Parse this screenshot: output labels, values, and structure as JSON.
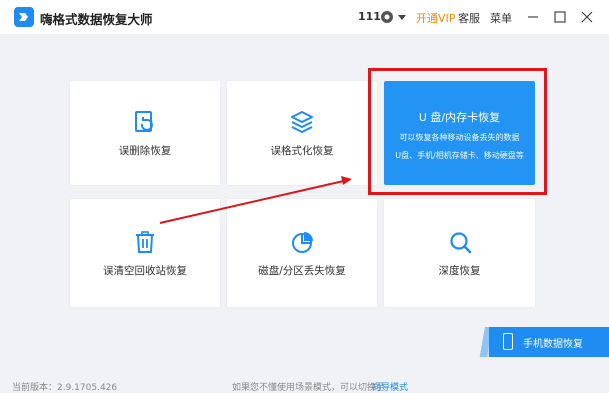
{
  "app": {
    "title": "嗨格式数据恢复大师"
  },
  "titlebar": {
    "points": "111",
    "vip_label": "开通VIP",
    "service_label": "客服",
    "menu_label": "菜单"
  },
  "cards": {
    "deleted": "误删除恢复",
    "format": "误格式化恢复",
    "recycle": "误清空回收站恢复",
    "partition": "磁盘/分区丢失恢复",
    "deep": "深度恢复"
  },
  "usb_card": {
    "title": "U 盘/内存卡恢复",
    "desc1": "可以恢复各种移动设备丢失的数据",
    "desc2": "U盘、手机/相机存储卡、移动硬盘等"
  },
  "phone_button": {
    "label": "手机数据恢复"
  },
  "footer": {
    "version": "当前版本：2.9.1705.426",
    "tip": "如果您不懂使用场景模式，可以切换至",
    "tip_link": "向导模式"
  },
  "colors": {
    "accent": "#1e8cf0",
    "vip": "#f08a00",
    "highlight": "#e0161b",
    "usb_card": "#2494f4"
  }
}
